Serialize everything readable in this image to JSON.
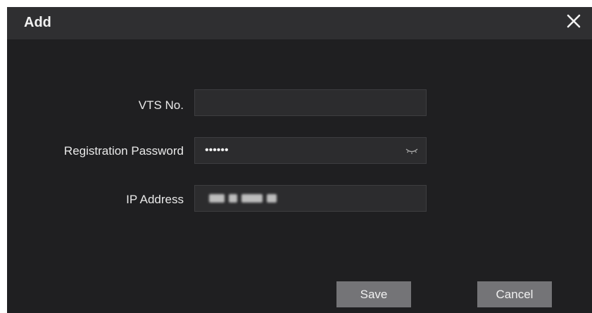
{
  "dialog": {
    "title": "Add",
    "close_icon": "close-icon"
  },
  "form": {
    "vts_no": {
      "label": "VTS No.",
      "value": ""
    },
    "registration_password": {
      "label": "Registration Password",
      "masked_value": "••••••",
      "toggle_icon": "eye-closed-icon"
    },
    "ip_address": {
      "label": "IP Address",
      "value_obscured": true
    }
  },
  "buttons": {
    "save_label": "Save",
    "cancel_label": "Cancel"
  },
  "colors": {
    "dialog_bg": "#1f1f21",
    "titlebar_bg": "#2f2f31",
    "field_bg": "#2c2c2e",
    "button_bg": "#747477"
  }
}
